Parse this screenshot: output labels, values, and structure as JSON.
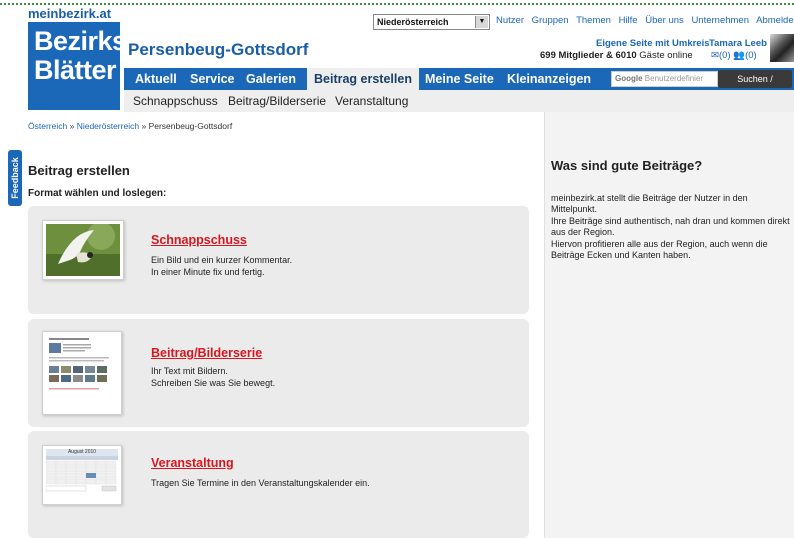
{
  "site": {
    "name": "meinbezirk.at",
    "logo_line1": "Bezirks",
    "logo_line2": "Blätter",
    "region_title": "Persenbeug-Gottsdorf"
  },
  "region_select": {
    "value": "Niederösterreich"
  },
  "top_nav": [
    "Nutzer",
    "Gruppen",
    "Themen",
    "Hilfe",
    "Über uns",
    "Unternehmen",
    "Abmelden"
  ],
  "user": {
    "own_page_link": "Eigene Seite mit Umkreis",
    "name": "Tamara Leeb",
    "members_count": "699",
    "members_text": "Mitglieder &",
    "guests_count": "6010",
    "guests_text": "Gäste online",
    "messages": "(0)",
    "friends": "(0)"
  },
  "main_nav": [
    "Aktuell",
    "Service",
    "Galerien",
    "Beitrag erstellen",
    "Meine Seite",
    "Kleinanzeigen"
  ],
  "search": {
    "brand": "Google",
    "placeholder": "Benutzerdefinier",
    "button": "Suchen /"
  },
  "sub_nav": [
    "Schnappschuss",
    "Beitrag/Bilderserie",
    "Veranstaltung"
  ],
  "breadcrumb": {
    "items": [
      "Österreich",
      "Niederösterreich"
    ],
    "current": "Persenbeug-Gottsdorf",
    "sep": "»"
  },
  "feedback_label": "Feedback",
  "page": {
    "title": "Beitrag erstellen",
    "subtitle": "Format wählen und loslegen:"
  },
  "cards": [
    {
      "title": "Schnappschuss",
      "line1": "Ein Bild und ein kurzer Kommentar.",
      "line2": "In einer Minute fix und fertig."
    },
    {
      "title": "Beitrag/Bilderserie",
      "line1": "Ihr Text mit Bildern.",
      "line2": "Schreiben Sie was Sie bewegt."
    },
    {
      "title": "Veranstaltung",
      "line1": "Tragen Sie Termine in den Veranstaltungskalender ein.",
      "line2": ""
    }
  ],
  "calendar_thumb": {
    "month": "August 2010",
    "button": "OK"
  },
  "sidebar": {
    "title": "Was sind gute Beiträge?",
    "p1": "meinbezirk.at stellt die Beiträge der Nutzer in den Mittelpunkt.",
    "p2": "Ihre Beiträge sind authentisch, nah dran und kommen direkt aus der Region.",
    "p3": "Hiervon profitieren alle aus der Region, auch wenn die Beiträge Ecken und Kanten haben."
  },
  "colors": {
    "brand_blue": "#1b67b8",
    "link_red": "#d8161e",
    "card_bg": "#ebebeb",
    "dots_green": "#3b8f3b"
  }
}
